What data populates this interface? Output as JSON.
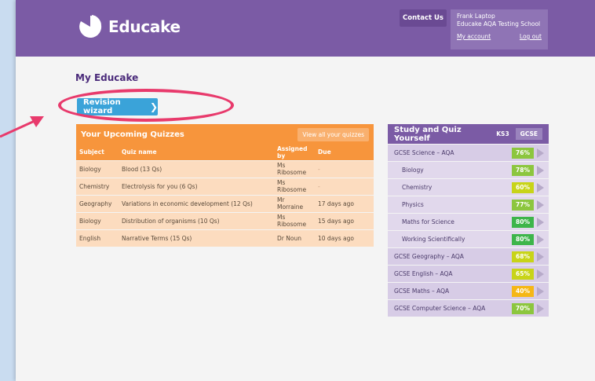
{
  "header": {
    "logo_text": "Educake",
    "contact_label": "Contact Us",
    "user_name": "Frank Laptop",
    "school": "Educake AQA Testing School",
    "my_account": "My account",
    "log_out": "Log out"
  },
  "page_title": "My Educake",
  "revision_wizard": "Revision wizard",
  "quizzes": {
    "title": "Your Upcoming Quizzes",
    "view_all": "View all your quizzes",
    "columns": [
      "Subject",
      "Quiz name",
      "Assigned by",
      "Due"
    ],
    "rows": [
      {
        "subject": "Biology",
        "quiz": "Blood (13 Qs)",
        "assigned": "Ms Ribosome",
        "due": "-"
      },
      {
        "subject": "Chemistry",
        "quiz": "Electrolysis for you (6 Qs)",
        "assigned": "Ms Ribosome",
        "due": "-"
      },
      {
        "subject": "Geography",
        "quiz": "Variations in economic development (12 Qs)",
        "assigned": "Mr Morraine",
        "due": "17 days ago"
      },
      {
        "subject": "Biology",
        "quiz": "Distribution of organisms (10 Qs)",
        "assigned": "Ms Ribosome",
        "due": "15 days ago"
      },
      {
        "subject": "English",
        "quiz": "Narrative Terms (15 Qs)",
        "assigned": "Dr Noun",
        "due": "10 days ago"
      }
    ]
  },
  "study": {
    "title": "Study and Quiz Yourself",
    "tabs": [
      "KS3",
      "GCSE"
    ],
    "rows": [
      {
        "name": "GCSE Science – AQA",
        "pct": "76%",
        "color": "#8cc63e",
        "sub": false
      },
      {
        "name": "Biology",
        "pct": "78%",
        "color": "#8cc63e",
        "sub": true
      },
      {
        "name": "Chemistry",
        "pct": "60%",
        "color": "#c8d418",
        "sub": true
      },
      {
        "name": "Physics",
        "pct": "77%",
        "color": "#8cc63e",
        "sub": true
      },
      {
        "name": "Maths for Science",
        "pct": "80%",
        "color": "#3db54a",
        "sub": true
      },
      {
        "name": "Working Scientifically",
        "pct": "80%",
        "color": "#3db54a",
        "sub": true
      },
      {
        "name": "GCSE Geography – AQA",
        "pct": "68%",
        "color": "#c8d418",
        "sub": false
      },
      {
        "name": "GCSE English – AQA",
        "pct": "65%",
        "color": "#c8d418",
        "sub": false
      },
      {
        "name": "GCSE Maths – AQA",
        "pct": "40%",
        "color": "#f5b715",
        "sub": false
      },
      {
        "name": "GCSE Computer Science – AQA",
        "pct": "70%",
        "color": "#8cc63e",
        "sub": false
      }
    ]
  }
}
